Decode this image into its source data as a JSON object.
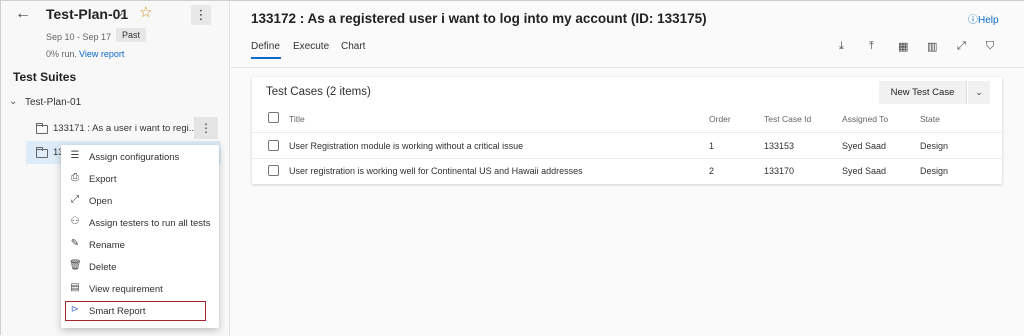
{
  "sidebar": {
    "plan_title": "Test-Plan-01",
    "dates": "Sep 10 - Sep 17",
    "badge": "Past",
    "run_text": "0% run.",
    "view_report": "View report",
    "suites_heading": "Test Suites",
    "tree": {
      "plan_node": "Test-Plan-01",
      "suite1": "133171 : As a user i want to regi...",
      "suite2": "13"
    },
    "context_menu": [
      {
        "label": "Assign configurations",
        "icon": "list-icon",
        "glyph": "☰"
      },
      {
        "label": "Export",
        "icon": "print-icon",
        "glyph": "⎙"
      },
      {
        "label": "Open",
        "icon": "expand-icon",
        "glyph": "⤢"
      },
      {
        "label": "Assign testers to run all tests",
        "icon": "assign-testers-icon",
        "glyph": "⚇"
      },
      {
        "label": "Rename",
        "icon": "rename-icon",
        "glyph": "✎"
      },
      {
        "label": "Delete",
        "icon": "trash-icon",
        "glyph": "🗑"
      },
      {
        "label": "View requirement",
        "icon": "document-icon",
        "glyph": "▤"
      },
      {
        "label": "Smart Report",
        "icon": "smart-report-icon",
        "glyph": "⊳"
      }
    ]
  },
  "main": {
    "title": "133172 : As a registered user i want to log into my account (ID: 133175)",
    "help": "Help",
    "tabs": [
      {
        "label": "Define"
      },
      {
        "label": "Execute"
      },
      {
        "label": "Chart"
      }
    ],
    "toolbar_icons": [
      "download-icon",
      "upload-icon",
      "grid-icon",
      "column-options-icon",
      "fullscreen-icon",
      "filter-icon"
    ],
    "card": {
      "title": "Test Cases (2 items)",
      "new_button": "New Test Case",
      "columns": [
        "Title",
        "Order",
        "Test Case Id",
        "Assigned To",
        "State"
      ],
      "rows": [
        {
          "title": "User Registration module is working without a critical issue",
          "order": "1",
          "id": "133153",
          "assigned": "Syed Saad",
          "state": "Design"
        },
        {
          "title": "User registration is working well for Continental US and Hawaii addresses",
          "order": "2",
          "id": "133170",
          "assigned": "Syed Saad",
          "state": "Design"
        }
      ]
    }
  },
  "colors": {
    "accent": "#0b6bc9",
    "star": "#d08a19",
    "highlight_border": "#a4262c",
    "selected_row": "#deecf9"
  }
}
